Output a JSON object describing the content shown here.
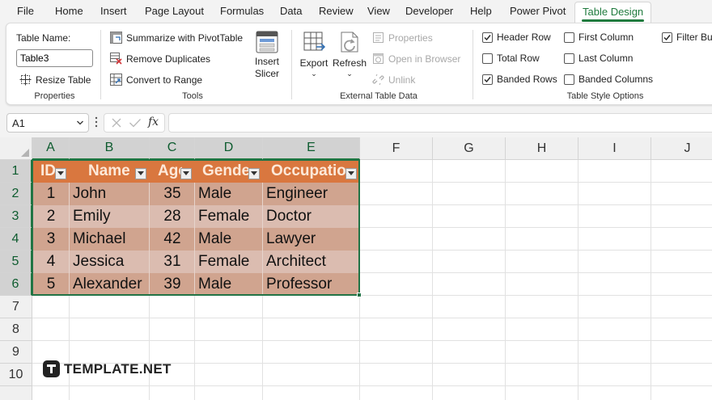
{
  "menu": {
    "tabs": [
      "File",
      "Home",
      "Insert",
      "Page Layout",
      "Formulas",
      "Data",
      "Review",
      "View",
      "Developer",
      "Help",
      "Power Pivot",
      "Table Design"
    ],
    "active": "Table Design"
  },
  "ribbon": {
    "properties": {
      "table_name_label": "Table Name:",
      "table_name_value": "Table3",
      "resize_table": "Resize Table",
      "group_label": "Properties"
    },
    "tools": {
      "summarize": "Summarize with PivotTable",
      "remove_duplicates": "Remove Duplicates",
      "convert_to_range": "Convert to Range",
      "insert_slicer_line1": "Insert",
      "insert_slicer_line2": "Slicer",
      "group_label": "Tools"
    },
    "external": {
      "export": "Export",
      "refresh": "Refresh",
      "properties": "Properties",
      "open_in_browser": "Open in Browser",
      "unlink": "Unlink",
      "group_label": "External Table Data"
    },
    "style_options": {
      "header_row": {
        "label": "Header Row",
        "checked": true
      },
      "total_row": {
        "label": "Total Row",
        "checked": false
      },
      "banded_rows": {
        "label": "Banded Rows",
        "checked": true
      },
      "first_column": {
        "label": "First Column",
        "checked": false
      },
      "last_column": {
        "label": "Last Column",
        "checked": false
      },
      "banded_columns": {
        "label": "Banded Columns",
        "checked": false
      },
      "filter_button": {
        "label": "Filter But",
        "checked": true
      },
      "group_label": "Table Style Options"
    }
  },
  "formula_bar": {
    "name_box": "A1",
    "fx": "fx",
    "formula": ""
  },
  "sheet": {
    "columns": [
      "A",
      "B",
      "C",
      "D",
      "E",
      "F",
      "G",
      "H",
      "I",
      "J"
    ],
    "rows": [
      "1",
      "2",
      "3",
      "4",
      "5",
      "6",
      "7",
      "8",
      "9",
      "10"
    ],
    "table_headers": [
      "ID",
      "Name",
      "Age",
      "Gender",
      "Occupation"
    ],
    "table_rows": [
      [
        "1",
        "John",
        "35",
        "Male",
        "Engineer"
      ],
      [
        "2",
        "Emily",
        "28",
        "Female",
        "Doctor"
      ],
      [
        "3",
        "Michael",
        "42",
        "Male",
        "Lawyer"
      ],
      [
        "4",
        "Jessica",
        "31",
        "Female",
        "Architect"
      ],
      [
        "5",
        "Alexander",
        "39",
        "Male",
        "Professor"
      ]
    ]
  },
  "colors": {
    "accent_green": "#1f7a3d",
    "table_header": "#d9773f",
    "band_dark": "#d0a48f",
    "band_light": "#dbbcb0"
  },
  "watermark": "TEMPLATE.NET"
}
